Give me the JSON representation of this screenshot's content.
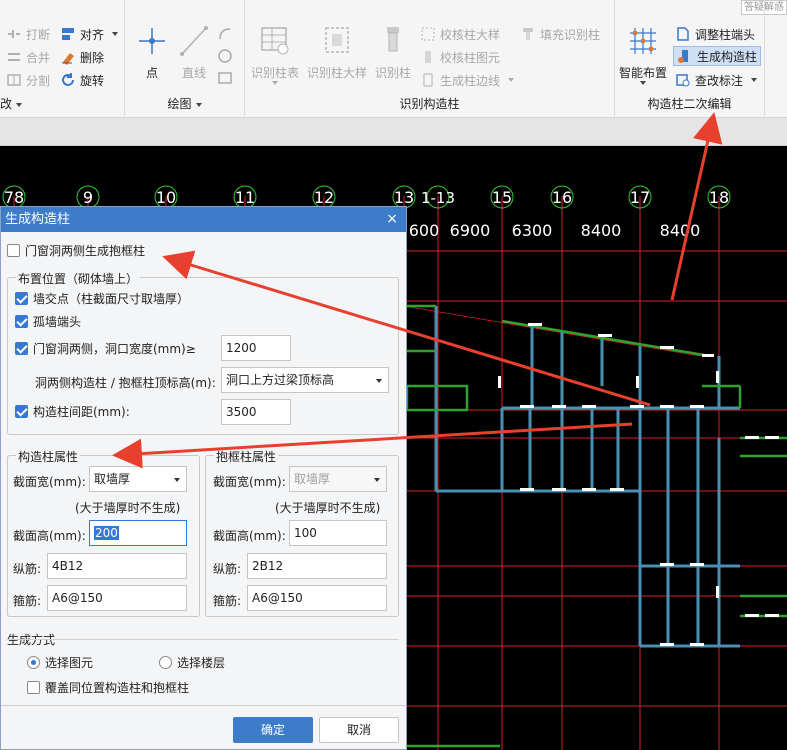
{
  "ribbon": {
    "corner_search": "答疑解惑",
    "modify_group": {
      "label": "改",
      "items": [
        "打断",
        "合并",
        "分割",
        "对齐",
        "删除",
        "旋转"
      ]
    },
    "draw_group": {
      "label": "绘图",
      "items": [
        "点",
        "直线"
      ]
    },
    "identify_group": {
      "label": "识别构造柱",
      "big": [
        "识别柱表",
        "识别柱大样",
        "识别柱"
      ],
      "small": [
        "校核柱大样",
        "校核柱图元",
        "生成柱边线",
        "填充识别柱"
      ]
    },
    "edit_group": {
      "label": "构造柱二次编辑",
      "big": "智能布置",
      "small": [
        "调整柱端头",
        "生成构造柱",
        "查改标注"
      ]
    }
  },
  "grid": {
    "axes": [
      "78",
      "9",
      "10",
      "11",
      "12",
      "13",
      "1-13",
      "15",
      "16",
      "17",
      "18"
    ],
    "dims": [
      "600",
      "6900",
      "6300",
      "8400",
      "8400"
    ]
  },
  "dialog": {
    "title": "生成构造柱",
    "close": "×",
    "door_window_frame": "门窗洞两侧生成抱框柱",
    "placement": {
      "title": "布置位置（砌体墙上）",
      "wall_intersection": "墙交点（柱截面尺寸取墙厚）",
      "isolated_wall_end": "孤墙端头",
      "opening_sides": "门窗洞两侧，洞口宽度(mm)≥",
      "opening_width": "1200",
      "top_elevation_label": "洞两侧构造柱 / 抱框柱顶标高(m):",
      "top_elevation_value": "洞口上方过梁顶标高",
      "spacing_label": "构造柱间距(mm):",
      "spacing_value": "3500"
    },
    "column_props": {
      "title": "构造柱属性",
      "width_label": "截面宽(mm):",
      "width_value": "取墙厚",
      "hint": "(大于墙厚时不生成)",
      "height_label": "截面高(mm):",
      "height_value": "200",
      "long_bar_label": "纵筋:",
      "long_bar_value": "4B12",
      "stirrup_label": "箍筋:",
      "stirrup_value": "A6@150"
    },
    "frame_props": {
      "title": "抱框柱属性",
      "width_label": "截面宽(mm):",
      "width_value": "取墙厚",
      "hint": "(大于墙厚时不生成)",
      "height_label": "截面高(mm):",
      "height_value": "100",
      "long_bar_label": "纵筋:",
      "long_bar_value": "2B12",
      "stirrup_label": "箍筋:",
      "stirrup_value": "A6@150"
    },
    "mode": {
      "title": "生成方式",
      "select_elements": "选择图元",
      "select_floors": "选择楼层",
      "overwrite": "覆盖同位置构造柱和抱框柱"
    },
    "ok": "确定",
    "cancel": "取消"
  },
  "colors": {
    "title_bar": "#3d7cc9",
    "annotation_arrow": "#e8402e",
    "grid_line": "#e0202a",
    "axis_circle": "#33cc33",
    "wall_blue": "#4a8fb5",
    "wall_green": "#2fa32f"
  }
}
